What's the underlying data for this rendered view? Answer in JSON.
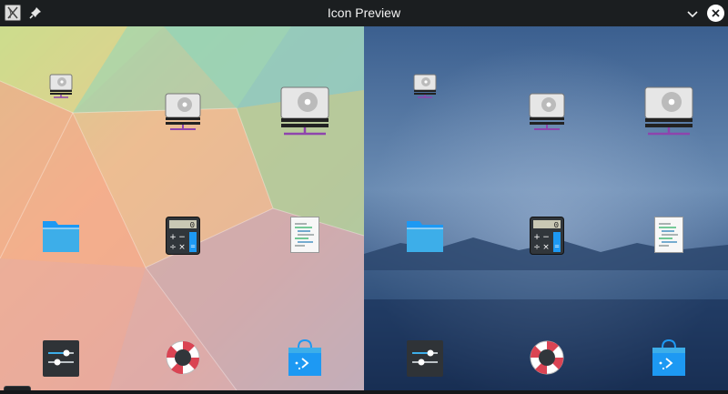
{
  "window": {
    "title": "Icon Preview"
  },
  "icons": {
    "row1": [
      "drive-harddisk",
      "drive-harddisk",
      "drive-harddisk"
    ],
    "row2": [
      "folder",
      "accessories-calculator",
      "text-x-generic"
    ],
    "row3": [
      "preferences-system",
      "help-browser",
      "plasma-discover"
    ]
  },
  "calculator": {
    "display": "0",
    "keys": [
      "+",
      "−",
      "÷",
      "×",
      "="
    ]
  },
  "colors": {
    "titlebar": "#1b1e20",
    "accent_purple": "#8e44ad",
    "folder_blue": "#3daee9",
    "lifebuoy_red": "#da4453"
  }
}
